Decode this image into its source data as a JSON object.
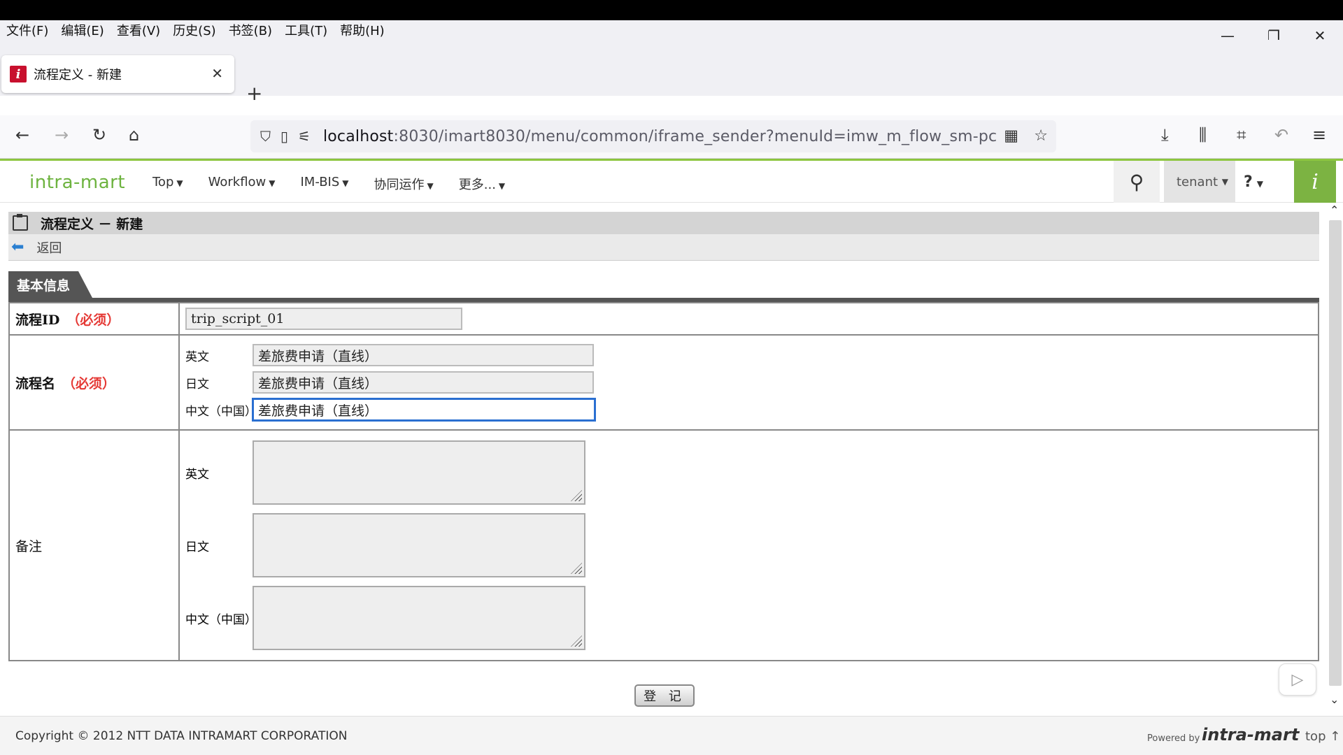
{
  "menubar": {
    "items": [
      "文件(F)",
      "编辑(E)",
      "查看(V)",
      "历史(S)",
      "书签(B)",
      "工具(T)",
      "帮助(H)"
    ]
  },
  "window": {
    "minimize": "—",
    "restore": "❐",
    "close": "✕"
  },
  "tab": {
    "title": "流程定义 - 新建",
    "close": "✕",
    "new_tab": "+"
  },
  "nav": {
    "url_host": "localhost",
    "url_rest": ":8030/imart8030/menu/common/iframe_sender?menuId=imw_m_flow_sm-pc"
  },
  "app": {
    "logo": "intra-mart",
    "nav": [
      "Top",
      "Workflow",
      "IM-BIS",
      "协同运作",
      "更多..."
    ],
    "tenant": "tenant",
    "help": "?"
  },
  "page": {
    "title": "流程定义 － 新建",
    "back": "返回",
    "section_tab": "基本信息",
    "flow_id": {
      "label": "流程ID",
      "required": "（必须）",
      "value": "trip_script_01"
    },
    "flow_name": {
      "label": "流程名",
      "required": "（必须）",
      "rows": [
        {
          "lang": "英文",
          "value": "差旅费申请（直线）"
        },
        {
          "lang": "日文",
          "value": "差旅费申请（直线）"
        },
        {
          "lang": "中文（中国）",
          "value": "差旅费申请（直线）"
        }
      ]
    },
    "remarks": {
      "label": "备注",
      "rows": [
        {
          "lang": "英文"
        },
        {
          "lang": "日文"
        },
        {
          "lang": "中文（中国）"
        }
      ]
    },
    "submit": "登 记"
  },
  "footer": {
    "copyright": "Copyright © 2012 NTT DATA INTRAMART CORPORATION",
    "powered": "Powered by",
    "powered_logo": "intra-mart",
    "top": "top ↑"
  },
  "colors": {
    "accent_green": "#8dc63f",
    "required_red": "#e53935",
    "focus_blue": "#2a6fd1"
  },
  "icons": [
    "back-icon",
    "forward-icon",
    "reload-icon",
    "home-icon",
    "shield-icon",
    "page-icon",
    "permissions-icon",
    "qr-icon",
    "star-icon",
    "download-icon",
    "library-icon",
    "crop-icon",
    "undo-icon",
    "menu-icon",
    "search-icon",
    "clipboard-icon",
    "back-arrow-icon",
    "play-icon"
  ]
}
